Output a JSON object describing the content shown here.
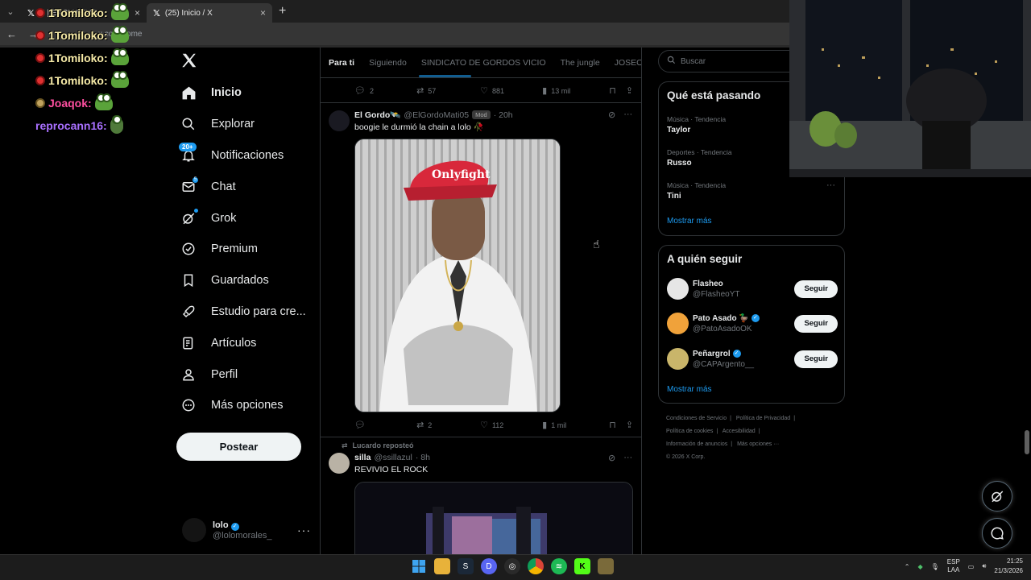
{
  "browser": {
    "tabs": [
      {
        "title": "X | EXCLUSIVO",
        "active": false
      },
      {
        "title": "(25) Inicio / X",
        "active": true
      }
    ],
    "new_tab_glyph": "+",
    "address": "x.com/home"
  },
  "stream_chat": [
    {
      "user": "1Tomiloko:",
      "color": "#f5e9a6",
      "badge": "red"
    },
    {
      "user": "1Tomiloko:",
      "color": "#f5e9a6",
      "badge": "red"
    },
    {
      "user": "1Tomiloko:",
      "color": "#f5e9a6",
      "badge": "red"
    },
    {
      "user": "1Tomiloko:",
      "color": "#f5e9a6",
      "badge": "red"
    },
    {
      "user": "Joaqok:",
      "color": "#ff4fa0",
      "badge": "gold"
    },
    {
      "user": "reprocann16:",
      "color": "#a970ff",
      "badge": "none"
    }
  ],
  "sidebar": {
    "logo": "X",
    "items": [
      {
        "label": "Inicio",
        "icon": "home-icon",
        "active": true
      },
      {
        "label": "Explorar",
        "icon": "search-icon"
      },
      {
        "label": "Notificaciones",
        "icon": "bell-icon",
        "badge": "20+"
      },
      {
        "label": "Chat",
        "icon": "mail-icon",
        "badge": "5"
      },
      {
        "label": "Grok",
        "icon": "grok-icon"
      },
      {
        "label": "Premium",
        "icon": "premium-icon"
      },
      {
        "label": "Guardados",
        "icon": "bookmark-icon"
      },
      {
        "label": "Estudio para cre...",
        "icon": "rocket-icon"
      },
      {
        "label": "Artículos",
        "icon": "article-icon"
      },
      {
        "label": "Perfil",
        "icon": "person-icon"
      },
      {
        "label": "Más opciones",
        "icon": "more-icon"
      }
    ],
    "post_button": "Postear",
    "account": {
      "name": "lolo",
      "handle": "@lolomorales_",
      "more": "···"
    }
  },
  "timeline": {
    "tabs": [
      "Para ti",
      "Siguiendo",
      "SINDICATO DE GORDOS VICIO",
      "The jungle",
      "JOSEO"
    ],
    "prev_tweet_actions": {
      "replies": "2",
      "reposts": "57",
      "likes": "881",
      "views": "13 mil"
    },
    "tweet1": {
      "name": "El Gordo🛰️",
      "handle": "@ElGordoMati05",
      "badge": "Mod",
      "time": "· 20h",
      "text": "boogie le durmió la chain a lolo 🥀",
      "actions": {
        "replies": "",
        "reposts": "2",
        "likes": "112",
        "views": "1 mil"
      }
    },
    "tweet2": {
      "reposted_by": "Lucardo reposteó",
      "name": "silla",
      "handle": "@ssillazul",
      "time": "· 8h",
      "text": "REVIVIO EL ROCK"
    }
  },
  "right": {
    "search_placeholder": "Buscar",
    "trends_title": "Qué está pasando",
    "trends": [
      {
        "category": "Música · Tendencia",
        "name": "Taylor"
      },
      {
        "category": "Deportes · Tendencia",
        "name": "Russo"
      },
      {
        "category": "Música · Tendencia",
        "name": "Tini"
      }
    ],
    "show_more": "Mostrar más",
    "follow_title": "A quién seguir",
    "follow": [
      {
        "name": "Flasheo",
        "handle": "@FlasheoYT",
        "verified": false,
        "button": "Seguir",
        "avatar_color": "#e6e6e6"
      },
      {
        "name": "Pato Asado 🦆",
        "handle": "@PatoAsadoOK",
        "verified": true,
        "button": "Seguir",
        "avatar_color": "#f0a23a"
      },
      {
        "name": "Peñargrol",
        "handle": "@CAPArgento__",
        "verified": true,
        "button": "Seguir",
        "avatar_color": "#c9b56a"
      }
    ],
    "follow_more": "Mostrar más",
    "footer": [
      "Condiciones de Servicio",
      "|",
      "Política de Privacidad",
      "|",
      "Política de cookies",
      "|",
      "Accesibilidad",
      "|",
      "Información de anuncios",
      "|",
      "Más opciones ···",
      "© 2026 X Corp."
    ]
  },
  "taskbar": {
    "lang": "ESP",
    "lang2": "LAA",
    "time": "21:25",
    "date": "21/3/2026"
  },
  "colors": {
    "accent": "#1d9bf0",
    "bg": "#000000",
    "muted": "#71767b",
    "text": "#e7e9ea"
  }
}
